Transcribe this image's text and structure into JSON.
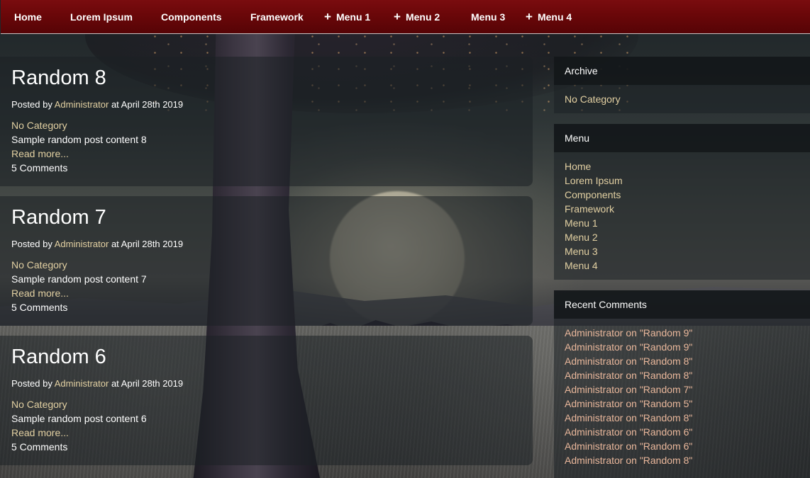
{
  "nav": {
    "items": [
      {
        "label": "Home",
        "has_plus": false
      },
      {
        "label": "Lorem Ipsum",
        "has_plus": false
      },
      {
        "label": "Components",
        "has_plus": false
      },
      {
        "label": "Framework",
        "has_plus": false
      },
      {
        "label": "Menu 1",
        "has_plus": true
      },
      {
        "label": "Menu 2",
        "has_plus": true
      },
      {
        "label": "Menu 3",
        "has_plus": false
      },
      {
        "label": "Menu 4",
        "has_plus": true
      }
    ],
    "plus_glyph": "+",
    "background_color": "#6a0709"
  },
  "posts": [
    {
      "title": "Random 8",
      "posted_by_prefix": "Posted by",
      "author": "Administrator",
      "date_text": "at April 28th 2019",
      "category": "No Category",
      "content": "Sample random post content 8",
      "read_more": "Read more...",
      "comments": "5 Comments"
    },
    {
      "title": "Random 7",
      "posted_by_prefix": "Posted by",
      "author": "Administrator",
      "date_text": "at April 28th 2019",
      "category": "No Category",
      "content": "Sample random post content 7",
      "read_more": "Read more...",
      "comments": "5 Comments"
    },
    {
      "title": "Random 6",
      "posted_by_prefix": "Posted by",
      "author": "Administrator",
      "date_text": "at April 28th 2019",
      "category": "No Category",
      "content": "Sample random post content 6",
      "read_more": "Read more...",
      "comments": "5 Comments"
    }
  ],
  "sidebar": {
    "archive": {
      "title": "Archive",
      "items": [
        "No Category"
      ]
    },
    "menu": {
      "title": "Menu",
      "items": [
        "Home",
        "Lorem Ipsum",
        "Components",
        "Framework",
        "Menu 1",
        "Menu 2",
        "Menu 3",
        "Menu 4"
      ]
    },
    "recent_comments": {
      "title": "Recent Comments",
      "items": [
        "Administrator on \"Random 9\"",
        "Administrator on \"Random 9\"",
        "Administrator on \"Random 8\"",
        "Administrator on \"Random 8\"",
        "Administrator on \"Random 7\"",
        "Administrator on \"Random 5\"",
        "Administrator on \"Random 8\"",
        "Administrator on \"Random 6\"",
        "Administrator on \"Random 6\"",
        "Administrator on \"Random 8\""
      ]
    }
  },
  "colors": {
    "link": "#e2d0a2",
    "recent_comment_link": "#e9b79b",
    "panel": "#1c2124"
  }
}
